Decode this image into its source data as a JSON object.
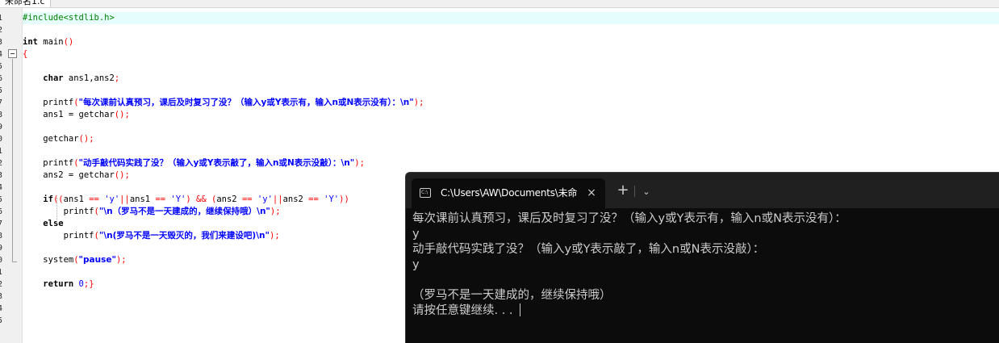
{
  "editor": {
    "tab_label": "未命名1.c",
    "active_line": 1,
    "lines": [
      {
        "n": "1",
        "tokens": [
          {
            "c": "pre",
            "t": "#include<stdlib.h>"
          }
        ]
      },
      {
        "n": "2",
        "tokens": []
      },
      {
        "n": "3",
        "tokens": [
          {
            "c": "kw",
            "t": "int"
          },
          {
            "c": "fn",
            "t": " main"
          },
          {
            "c": "br",
            "t": "()"
          }
        ]
      },
      {
        "n": "4",
        "tokens": [
          {
            "c": "br",
            "t": "{"
          }
        ]
      },
      {
        "n": "5",
        "tokens": []
      },
      {
        "n": "6",
        "tokens": [
          {
            "c": "fn",
            "t": "    "
          },
          {
            "c": "kw",
            "t": "char"
          },
          {
            "c": "fn",
            "t": " ans1,ans2"
          },
          {
            "c": "op",
            "t": ";"
          }
        ]
      },
      {
        "n": "5",
        "tokens": []
      },
      {
        "n": "7",
        "tokens": [
          {
            "c": "fn",
            "t": "    printf"
          },
          {
            "c": "br",
            "t": "("
          },
          {
            "c": "str",
            "t": "\"每次课前认真预习，课后及时复习了没？（输入y或Y表示有，输入n或N表示没有）：\\n\""
          },
          {
            "c": "br",
            "t": ")"
          },
          {
            "c": "op",
            "t": ";"
          }
        ]
      },
      {
        "n": "8",
        "tokens": [
          {
            "c": "fn",
            "t": "    ans1 = getchar"
          },
          {
            "c": "br",
            "t": "()"
          },
          {
            "c": "op",
            "t": ";"
          }
        ]
      },
      {
        "n": "9",
        "tokens": []
      },
      {
        "n": "0",
        "tokens": [
          {
            "c": "fn",
            "t": "    getchar"
          },
          {
            "c": "br",
            "t": "()"
          },
          {
            "c": "op",
            "t": ";"
          }
        ]
      },
      {
        "n": "1",
        "tokens": []
      },
      {
        "n": "2",
        "tokens": [
          {
            "c": "fn",
            "t": "    printf"
          },
          {
            "c": "br",
            "t": "("
          },
          {
            "c": "str",
            "t": "\"动手敲代码实践了没？（输入y或Y表示敲了，输入n或N表示没敲）：\\n\""
          },
          {
            "c": "br",
            "t": ")"
          },
          {
            "c": "op",
            "t": ";"
          }
        ]
      },
      {
        "n": "3",
        "tokens": [
          {
            "c": "fn",
            "t": "    ans2 = getchar"
          },
          {
            "c": "br",
            "t": "()"
          },
          {
            "c": "op",
            "t": ";"
          }
        ]
      },
      {
        "n": "4",
        "tokens": []
      },
      {
        "n": "5",
        "tokens": [
          {
            "c": "fn",
            "t": "    "
          },
          {
            "c": "kw",
            "t": "if"
          },
          {
            "c": "br",
            "t": "(("
          },
          {
            "c": "fn",
            "t": "ans1 "
          },
          {
            "c": "op",
            "t": "=="
          },
          {
            "c": "chr",
            "t": " 'y'"
          },
          {
            "c": "op",
            "t": "||"
          },
          {
            "c": "fn",
            "t": "ans1 "
          },
          {
            "c": "op",
            "t": "=="
          },
          {
            "c": "chr",
            "t": " 'Y'"
          },
          {
            "c": "br",
            "t": ")"
          },
          {
            "c": "op",
            "t": " &&"
          },
          {
            "c": "br",
            "t": " ("
          },
          {
            "c": "fn",
            "t": "ans2 "
          },
          {
            "c": "op",
            "t": "=="
          },
          {
            "c": "chr",
            "t": " 'y'"
          },
          {
            "c": "op",
            "t": "||"
          },
          {
            "c": "fn",
            "t": "ans2 "
          },
          {
            "c": "op",
            "t": "=="
          },
          {
            "c": "chr",
            "t": " 'Y'"
          },
          {
            "c": "br",
            "t": "))"
          }
        ]
      },
      {
        "n": "6",
        "tokens": [
          {
            "c": "fn",
            "t": "        printf"
          },
          {
            "c": "br",
            "t": "("
          },
          {
            "c": "str",
            "t": "\"\\n（罗马不是一天建成的，继续保持哦）\\n\""
          },
          {
            "c": "br",
            "t": ")"
          },
          {
            "c": "op",
            "t": ";"
          }
        ]
      },
      {
        "n": "7",
        "tokens": [
          {
            "c": "fn",
            "t": "    "
          },
          {
            "c": "kw",
            "t": "else"
          }
        ]
      },
      {
        "n": "8",
        "tokens": [
          {
            "c": "fn",
            "t": "        printf"
          },
          {
            "c": "br",
            "t": "("
          },
          {
            "c": "str",
            "t": "\"\\n(罗马不是一天毁灭的，我们来建设吧)\\n\""
          },
          {
            "c": "br",
            "t": ")"
          },
          {
            "c": "op",
            "t": ";"
          }
        ]
      },
      {
        "n": "9",
        "tokens": []
      },
      {
        "n": "0",
        "tokens": [
          {
            "c": "fn",
            "t": "    system"
          },
          {
            "c": "br",
            "t": "("
          },
          {
            "c": "str",
            "t": "\"pause\""
          },
          {
            "c": "br",
            "t": ")"
          },
          {
            "c": "op",
            "t": ";"
          }
        ]
      },
      {
        "n": "1",
        "tokens": []
      },
      {
        "n": "2",
        "tokens": [
          {
            "c": "fn",
            "t": "    "
          },
          {
            "c": "kw",
            "t": "return"
          },
          {
            "c": "num",
            "t": " 0"
          },
          {
            "c": "op",
            "t": ";"
          },
          {
            "c": "br",
            "t": "}"
          }
        ]
      },
      {
        "n": "3",
        "tokens": []
      },
      {
        "n": "4",
        "tokens": []
      },
      {
        "n": "5",
        "tokens": []
      }
    ]
  },
  "terminal": {
    "tab_title": "C:\\Users\\AW\\Documents\\未命",
    "close_icon": "×",
    "new_tab_icon": "+",
    "dropdown_icon": "⌄",
    "output": [
      "每次课前认真预习，课后及时复习了没？（输入y或Y表示有，输入n或N表示没有）：",
      "y",
      "动手敲代码实践了没？（输入y或Y表示敲了，输入n或N表示没敲）：",
      "y",
      "",
      "（罗马不是一天建成的，继续保持哦）",
      "请按任意键继续. . . "
    ]
  }
}
